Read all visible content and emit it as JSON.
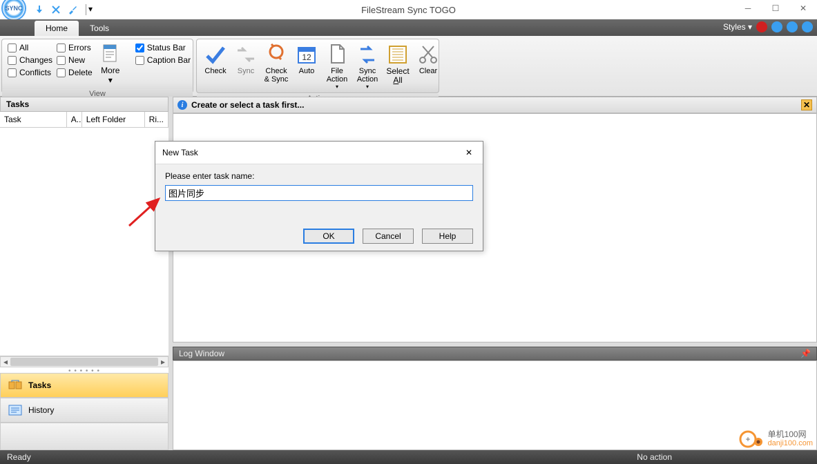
{
  "app": {
    "title": "FileStream Sync TOGO"
  },
  "tabs": {
    "home": "Home",
    "tools": "Tools"
  },
  "styles_label": "Styles",
  "ribbon": {
    "view": {
      "label": "View",
      "all": "All",
      "errors": "Errors",
      "changes": "Changes",
      "new": "New",
      "conflicts": "Conflicts",
      "delete": "Delete",
      "more": "More",
      "status_bar": "Status Bar",
      "caption_bar": "Caption Bar"
    },
    "action": {
      "label": "Action",
      "check": "Check",
      "sync": "Sync",
      "check_sync": "Check\n& Sync",
      "auto": "Auto",
      "file_action": "File\nAction",
      "sync_action": "Sync\nAction",
      "select_all": "Select\nAll",
      "clear": "Clear"
    }
  },
  "left": {
    "header": "Tasks",
    "cols": {
      "task": "Task",
      "a": "A..",
      "left": "Left Folder",
      "right": "Ri..."
    },
    "nav_tasks": "Tasks",
    "nav_history": "History"
  },
  "info": {
    "msg": "Create or select a task first..."
  },
  "log": {
    "header": "Log Window"
  },
  "status": {
    "left": "Ready",
    "right": "No action"
  },
  "dialog": {
    "title": "New Task",
    "prompt": "Please enter task name:",
    "value": "图片同步",
    "ok": "OK",
    "cancel": "Cancel",
    "help": "Help"
  },
  "watermark": {
    "cn": "单机100网",
    "url": "danji100.com"
  }
}
